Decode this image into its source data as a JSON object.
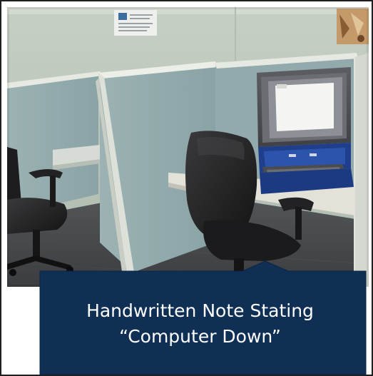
{
  "callout": {
    "line1": "Handwritten Note Stating",
    "line2": "“Computer Down”",
    "background_color": "#0f2f55",
    "text_color": "#ffffff"
  },
  "photo": {
    "subject": "Empty office cubicles with a black task chair facing a kiosk computer terminal that has a paper note taped over its screen"
  }
}
